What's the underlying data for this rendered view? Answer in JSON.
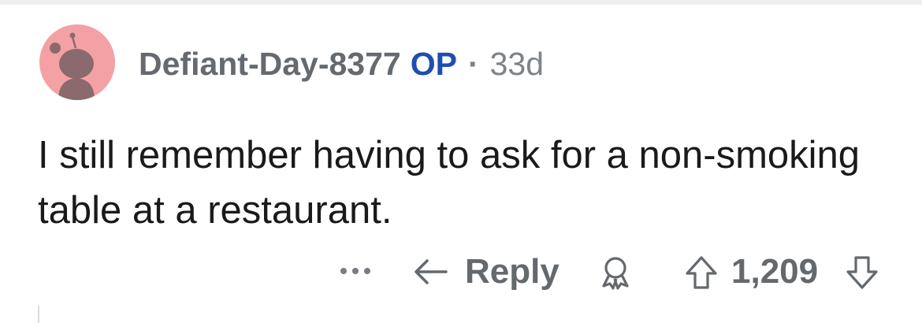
{
  "comment": {
    "author": "Defiant-Day-8377",
    "op_label": "OP",
    "separator": "·",
    "age": "33d",
    "body": "I still remember having to ask for a non-smoking table at a restaurant.",
    "avatar_color": "#f4a1a5"
  },
  "actions": {
    "more_icon": "ellipsis-icon",
    "reply_label": "Reply",
    "reply_icon": "reply-arrow-icon",
    "award_icon": "award-icon",
    "upvote_icon": "upvote-arrow-icon",
    "score": "1,209",
    "downvote_icon": "downvote-arrow-icon"
  }
}
